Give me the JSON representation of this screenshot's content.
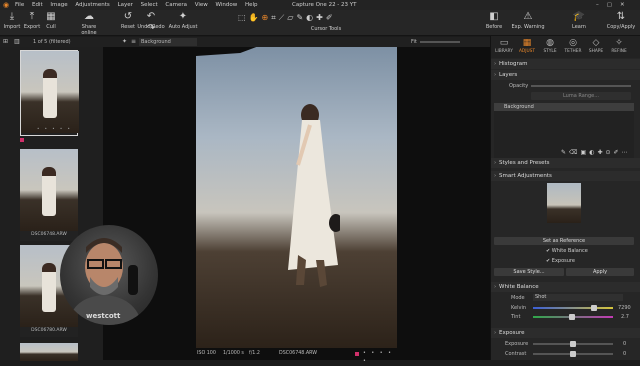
{
  "menubar": {
    "items": [
      "File",
      "Edit",
      "Image",
      "Adjustments",
      "Layer",
      "Select",
      "Camera",
      "View",
      "Window",
      "Help"
    ],
    "title": "Capture One 22 - 23 YT"
  },
  "toolbar": {
    "left": [
      {
        "label": "Import",
        "icon": "import-icon"
      },
      {
        "label": "Export",
        "icon": "export-icon"
      },
      {
        "label": "Cull",
        "icon": "cull-icon"
      },
      {
        "label": "Share online",
        "icon": "share-icon"
      },
      {
        "label": "Reset",
        "icon": "reset-icon"
      },
      {
        "label": "Undo/Redo",
        "icon": "undo-icon"
      },
      {
        "label": "Auto Adjust",
        "icon": "auto-adjust-icon"
      }
    ],
    "center_label": "Cursor Tools",
    "right": [
      {
        "label": "Before",
        "icon": "before-icon"
      },
      {
        "label": "Exp. Warning",
        "icon": "exposure-warning-icon"
      },
      {
        "label": "Learn",
        "icon": "learn-icon"
      },
      {
        "label": "Copy/Apply",
        "icon": "copy-apply-icon"
      }
    ]
  },
  "subbar": {
    "counter": "1 of 5 (filtered)",
    "layer": "Background",
    "fit": "Fit"
  },
  "browser": {
    "thumbs": [
      {
        "label": ""
      },
      {
        "label": "DSC06748.ARW"
      },
      {
        "label": "DSC06780.ARW"
      },
      {
        "label": "DSC06781.ARW"
      },
      {
        "label": ""
      }
    ]
  },
  "viewer": {
    "iso": "ISO 100",
    "shutter": "1/1000 s",
    "aperture": "f/1.2",
    "filename": "DSC06748.ARW"
  },
  "webcam": {
    "brand": "westcott"
  },
  "tool_tabs": [
    "LIBRARY",
    "ADJUST",
    "STYLE",
    "TETHER",
    "SHAPE",
    "REFINE"
  ],
  "panels": {
    "histogram": "Histogram",
    "layers": "Layers",
    "opacity_label": "Opacity",
    "luma_range": "Luma Range...",
    "background_layer": "Background",
    "styles": "Styles and Presets",
    "smart": "Smart Adjustments",
    "set_reference": "Set as Reference",
    "white_balance_check": "White Balance",
    "exposure_check": "Exposure",
    "save_style": "Save Style...",
    "apply": "Apply",
    "white_balance": "White Balance",
    "mode_label": "Mode",
    "mode_value": "Shot",
    "kelvin_label": "Kelvin",
    "kelvin_value": "7290",
    "tint_label": "Tint",
    "tint_value": "2.7",
    "exposure_section": "Exposure",
    "exposure_label": "Exposure",
    "exposure_value": "0",
    "contrast_label": "Contrast",
    "contrast_value": "0"
  },
  "colors": {
    "accent": "#e8862a",
    "selected_frame": "#d8d8d8",
    "rating_red": "#d0306a"
  }
}
